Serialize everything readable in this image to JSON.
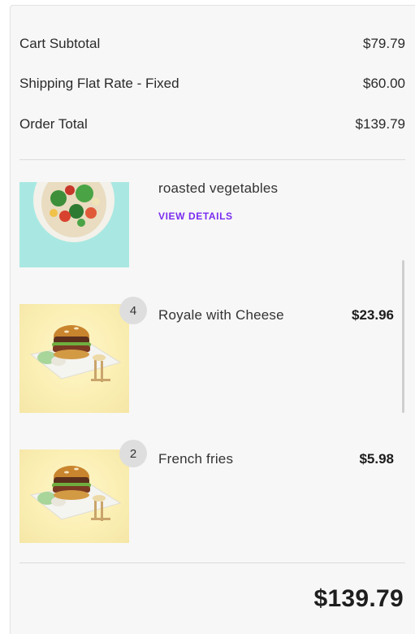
{
  "summary": {
    "subtotal_label": "Cart Subtotal",
    "subtotal_value": "$79.79",
    "shipping_label": "Shipping Flat Rate - Fixed",
    "shipping_value": "$60.00",
    "total_label": "Order Total",
    "total_value": "$139.79"
  },
  "items": [
    {
      "name": "roasted vegetables",
      "link_label": "VIEW DETAILS",
      "image": "salad-bowl-image"
    },
    {
      "quantity": "4",
      "name": "Royale with Cheese",
      "price": "$23.96",
      "image": "burger-plate-image"
    },
    {
      "quantity": "2",
      "name": "French fries",
      "price": "$5.98",
      "image": "burger-plate-image"
    }
  ],
  "grand_total": "$139.79",
  "colors": {
    "link": "#7a2cf0",
    "panel_bg": "#f7f7f7",
    "badge_bg": "#dedede",
    "salad_bg": "#a9e8e2"
  }
}
